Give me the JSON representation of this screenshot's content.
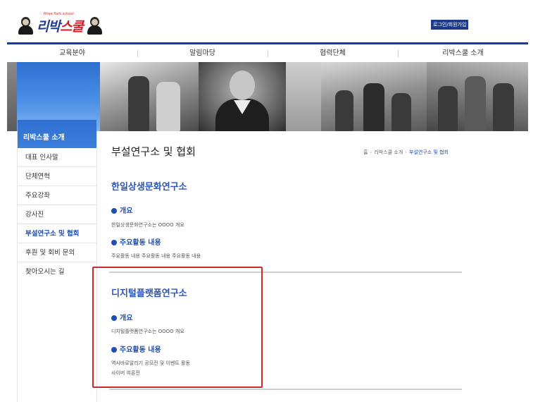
{
  "header": {
    "logo_tag": "Rhee Park school",
    "logo_text_main": "리박",
    "logo_text_accent": "스쿨",
    "login_label": "로그인/회원가입"
  },
  "nav": {
    "items": [
      "교육분야",
      "알림마당",
      "협력단체",
      "리박스쿨 소개"
    ]
  },
  "sidebar": {
    "title": "리박스쿨 소개",
    "items": [
      {
        "label": "대표 인사말"
      },
      {
        "label": "단체연혁"
      },
      {
        "label": "주요강좌"
      },
      {
        "label": "강사진"
      },
      {
        "label": "부설연구소 및 협회",
        "active": true
      },
      {
        "label": "후원 및 회비 문의"
      },
      {
        "label": "찾아오시는 길"
      }
    ]
  },
  "main": {
    "title": "부설연구소 및 협회",
    "breadcrumb": [
      "홈",
      "리박스쿨 소개",
      "부설연구소 및 협회"
    ],
    "sections": [
      {
        "title": "한일상생문화연구소",
        "overview_heading": "개요",
        "overview_text": "한일상생문화연구소는 OOOO 개요",
        "activities_heading": "주요활동 내용",
        "activities_text": [
          "주요활동 내용 주요활동 내용 주요활동 내용"
        ]
      },
      {
        "title": "디지털플랫폼연구소",
        "overview_heading": "개요",
        "overview_text": "디지털플랫폼연구소는 OOOO 개요",
        "activities_heading": "주요활동 내용",
        "activities_text": [
          "역사바로알리기 공모전 및 이벤트 활동",
          "사이버 여론전"
        ]
      }
    ]
  },
  "colors": {
    "brand_blue": "#1d3a8a",
    "accent_blue": "#1d4fb4",
    "highlight_red": "#cc2b2b"
  }
}
